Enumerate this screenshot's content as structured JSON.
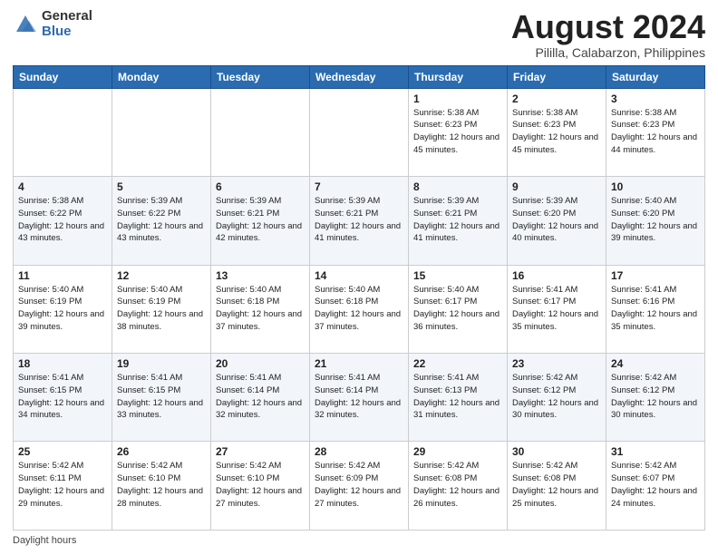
{
  "header": {
    "logo_general": "General",
    "logo_blue": "Blue",
    "title": "August 2024",
    "location": "Pililla, Calabarzon, Philippines"
  },
  "days_of_week": [
    "Sunday",
    "Monday",
    "Tuesday",
    "Wednesday",
    "Thursday",
    "Friday",
    "Saturday"
  ],
  "footer": {
    "daylight_label": "Daylight hours"
  },
  "weeks": [
    [
      {
        "day": "",
        "info": ""
      },
      {
        "day": "",
        "info": ""
      },
      {
        "day": "",
        "info": ""
      },
      {
        "day": "",
        "info": ""
      },
      {
        "day": "1",
        "info": "Sunrise: 5:38 AM\nSunset: 6:23 PM\nDaylight: 12 hours\nand 45 minutes."
      },
      {
        "day": "2",
        "info": "Sunrise: 5:38 AM\nSunset: 6:23 PM\nDaylight: 12 hours\nand 45 minutes."
      },
      {
        "day": "3",
        "info": "Sunrise: 5:38 AM\nSunset: 6:23 PM\nDaylight: 12 hours\nand 44 minutes."
      }
    ],
    [
      {
        "day": "4",
        "info": "Sunrise: 5:38 AM\nSunset: 6:22 PM\nDaylight: 12 hours\nand 43 minutes."
      },
      {
        "day": "5",
        "info": "Sunrise: 5:39 AM\nSunset: 6:22 PM\nDaylight: 12 hours\nand 43 minutes."
      },
      {
        "day": "6",
        "info": "Sunrise: 5:39 AM\nSunset: 6:21 PM\nDaylight: 12 hours\nand 42 minutes."
      },
      {
        "day": "7",
        "info": "Sunrise: 5:39 AM\nSunset: 6:21 PM\nDaylight: 12 hours\nand 41 minutes."
      },
      {
        "day": "8",
        "info": "Sunrise: 5:39 AM\nSunset: 6:21 PM\nDaylight: 12 hours\nand 41 minutes."
      },
      {
        "day": "9",
        "info": "Sunrise: 5:39 AM\nSunset: 6:20 PM\nDaylight: 12 hours\nand 40 minutes."
      },
      {
        "day": "10",
        "info": "Sunrise: 5:40 AM\nSunset: 6:20 PM\nDaylight: 12 hours\nand 39 minutes."
      }
    ],
    [
      {
        "day": "11",
        "info": "Sunrise: 5:40 AM\nSunset: 6:19 PM\nDaylight: 12 hours\nand 39 minutes."
      },
      {
        "day": "12",
        "info": "Sunrise: 5:40 AM\nSunset: 6:19 PM\nDaylight: 12 hours\nand 38 minutes."
      },
      {
        "day": "13",
        "info": "Sunrise: 5:40 AM\nSunset: 6:18 PM\nDaylight: 12 hours\nand 37 minutes."
      },
      {
        "day": "14",
        "info": "Sunrise: 5:40 AM\nSunset: 6:18 PM\nDaylight: 12 hours\nand 37 minutes."
      },
      {
        "day": "15",
        "info": "Sunrise: 5:40 AM\nSunset: 6:17 PM\nDaylight: 12 hours\nand 36 minutes."
      },
      {
        "day": "16",
        "info": "Sunrise: 5:41 AM\nSunset: 6:17 PM\nDaylight: 12 hours\nand 35 minutes."
      },
      {
        "day": "17",
        "info": "Sunrise: 5:41 AM\nSunset: 6:16 PM\nDaylight: 12 hours\nand 35 minutes."
      }
    ],
    [
      {
        "day": "18",
        "info": "Sunrise: 5:41 AM\nSunset: 6:15 PM\nDaylight: 12 hours\nand 34 minutes."
      },
      {
        "day": "19",
        "info": "Sunrise: 5:41 AM\nSunset: 6:15 PM\nDaylight: 12 hours\nand 33 minutes."
      },
      {
        "day": "20",
        "info": "Sunrise: 5:41 AM\nSunset: 6:14 PM\nDaylight: 12 hours\nand 32 minutes."
      },
      {
        "day": "21",
        "info": "Sunrise: 5:41 AM\nSunset: 6:14 PM\nDaylight: 12 hours\nand 32 minutes."
      },
      {
        "day": "22",
        "info": "Sunrise: 5:41 AM\nSunset: 6:13 PM\nDaylight: 12 hours\nand 31 minutes."
      },
      {
        "day": "23",
        "info": "Sunrise: 5:42 AM\nSunset: 6:12 PM\nDaylight: 12 hours\nand 30 minutes."
      },
      {
        "day": "24",
        "info": "Sunrise: 5:42 AM\nSunset: 6:12 PM\nDaylight: 12 hours\nand 30 minutes."
      }
    ],
    [
      {
        "day": "25",
        "info": "Sunrise: 5:42 AM\nSunset: 6:11 PM\nDaylight: 12 hours\nand 29 minutes."
      },
      {
        "day": "26",
        "info": "Sunrise: 5:42 AM\nSunset: 6:10 PM\nDaylight: 12 hours\nand 28 minutes."
      },
      {
        "day": "27",
        "info": "Sunrise: 5:42 AM\nSunset: 6:10 PM\nDaylight: 12 hours\nand 27 minutes."
      },
      {
        "day": "28",
        "info": "Sunrise: 5:42 AM\nSunset: 6:09 PM\nDaylight: 12 hours\nand 27 minutes."
      },
      {
        "day": "29",
        "info": "Sunrise: 5:42 AM\nSunset: 6:08 PM\nDaylight: 12 hours\nand 26 minutes."
      },
      {
        "day": "30",
        "info": "Sunrise: 5:42 AM\nSunset: 6:08 PM\nDaylight: 12 hours\nand 25 minutes."
      },
      {
        "day": "31",
        "info": "Sunrise: 5:42 AM\nSunset: 6:07 PM\nDaylight: 12 hours\nand 24 minutes."
      }
    ]
  ]
}
